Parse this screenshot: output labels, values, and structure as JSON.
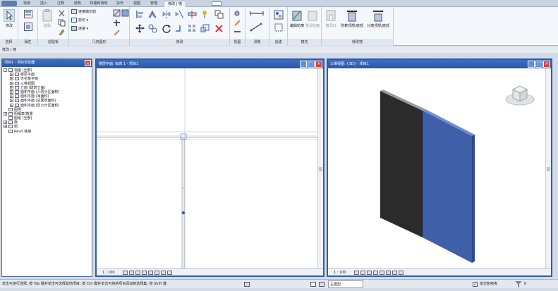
{
  "ribbon_tabs": [
    "常用",
    "插入",
    "注释",
    "结构",
    "体量和场地",
    "协作",
    "视图",
    "管理",
    "修改 | 墙"
  ],
  "ribbon_groups": {
    "select": {
      "label": "选择",
      "btn": "修改"
    },
    "properties": {
      "label": "属性"
    },
    "clipboard": {
      "label": "剪贴板",
      "paste": "粘贴"
    },
    "geometry": {
      "label": "几何图形",
      "items": [
        "连接端切割",
        "剪切",
        "连接"
      ]
    },
    "modify": {
      "label": "修改"
    },
    "view": {
      "label": "视图"
    },
    "measure": {
      "label": "测量"
    },
    "create": {
      "label": "创建"
    },
    "mode": {
      "label": "模式",
      "btn1": "编辑轮廓",
      "btn2": "重设轮廓"
    },
    "modify_wall": {
      "label": "修改墙",
      "btn1": "墙洞口",
      "btn2": "附着顶部/底部",
      "btn3": "分离顶部/底部"
    }
  },
  "options_bar": "修改 | 墙",
  "project_browser": {
    "title": "项目1 - 项目浏览器",
    "items": [
      {
        "text": "视图 (全部)",
        "level": 0,
        "exp": "-"
      },
      {
        "text": "楼层平面",
        "level": 1,
        "exp": "+"
      },
      {
        "text": "天花板平面",
        "level": 1,
        "exp": "+"
      },
      {
        "text": "三维视图",
        "level": 1,
        "exp": "+"
      },
      {
        "text": "立面 (建筑立面)",
        "level": 1,
        "exp": "+"
      },
      {
        "text": "面积平面 (人防分区面积)",
        "level": 1,
        "exp": "+"
      },
      {
        "text": "面积平面 (净面积)",
        "level": 1,
        "exp": "+"
      },
      {
        "text": "面积平面 (总建筑面积)",
        "level": 1,
        "exp": "+"
      },
      {
        "text": "面积平面 (防火分区面积)",
        "level": 1,
        "exp": "+"
      },
      {
        "text": "图例",
        "level": 0,
        "exp": ""
      },
      {
        "text": "明细表/数量",
        "level": 0,
        "exp": "+"
      },
      {
        "text": "图纸 (全部)",
        "level": 0,
        "exp": ""
      },
      {
        "text": "族",
        "level": 0,
        "exp": "+"
      },
      {
        "text": "组",
        "level": 0,
        "exp": "+"
      },
      {
        "text": "Revit 链接",
        "level": 0,
        "exp": ""
      }
    ]
  },
  "floor_view": {
    "title": "楼层平面: 标高 1 - 项目1",
    "scale": "1 : 100"
  },
  "view3d": {
    "title": "三维视图: {3D} - 项目1",
    "scale": "1 : 100"
  },
  "status": {
    "text": "单击可进行选择; 按 Tab 键并单击可选择其他项目; 按 Ctrl 键并单击可将新项目添加到选择集; 按 Shift 键",
    "model": "主模型",
    "checkbox_label": "单击和拖曳",
    "filter": "0"
  },
  "colors": {
    "titlebar": "#2f5ca8",
    "wall_dark": "#2b2b2b",
    "wall_blue": "#3f5fa8"
  }
}
